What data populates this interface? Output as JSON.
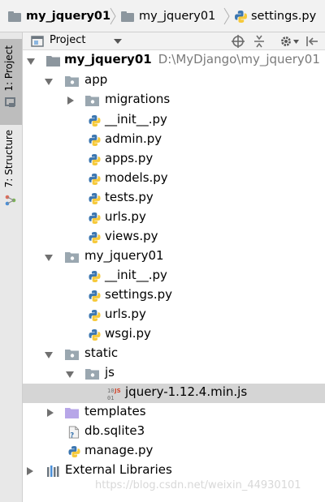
{
  "breadcrumb": [
    {
      "label": "my_jquery01",
      "icon": "folder-icon",
      "bold": true
    },
    {
      "label": "my_jquery01",
      "icon": "folder-icon",
      "bold": false
    },
    {
      "label": "settings.py",
      "icon": "python-file-icon",
      "bold": false
    }
  ],
  "left_strip": {
    "project_tab": "1: Project",
    "structure_tab": "7: Structure"
  },
  "panel": {
    "title": "Project",
    "toolbar_icons": [
      "scroll-from-source-icon",
      "collapse-all-icon",
      "settings-gear-icon",
      "hide-icon"
    ]
  },
  "tree": {
    "root_name": "my_jquery01",
    "root_path": "D:\\MyDjango\\my_jquery01",
    "items": [
      {
        "label": "app"
      },
      {
        "label": "migrations"
      },
      {
        "label": "__init__.py"
      },
      {
        "label": "admin.py"
      },
      {
        "label": "apps.py"
      },
      {
        "label": "models.py"
      },
      {
        "label": "tests.py"
      },
      {
        "label": "urls.py"
      },
      {
        "label": "views.py"
      },
      {
        "label": "my_jquery01"
      },
      {
        "label": "__init__.py"
      },
      {
        "label": "settings.py"
      },
      {
        "label": "urls.py"
      },
      {
        "label": "wsgi.py"
      },
      {
        "label": "static"
      },
      {
        "label": "js"
      },
      {
        "label": "jquery-1.12.4.min.js"
      },
      {
        "label": "templates"
      },
      {
        "label": "db.sqlite3"
      },
      {
        "label": "manage.py"
      },
      {
        "label": "External Libraries"
      }
    ]
  },
  "watermark": "https://blog.csdn.net/weixin_44930101",
  "colors": {
    "folder": "#9aa7b0",
    "templates_folder": "#b7a6e8",
    "python_blue": "#3b76b0",
    "python_yellow": "#f6c93a",
    "selection": "#d5d5d5"
  }
}
